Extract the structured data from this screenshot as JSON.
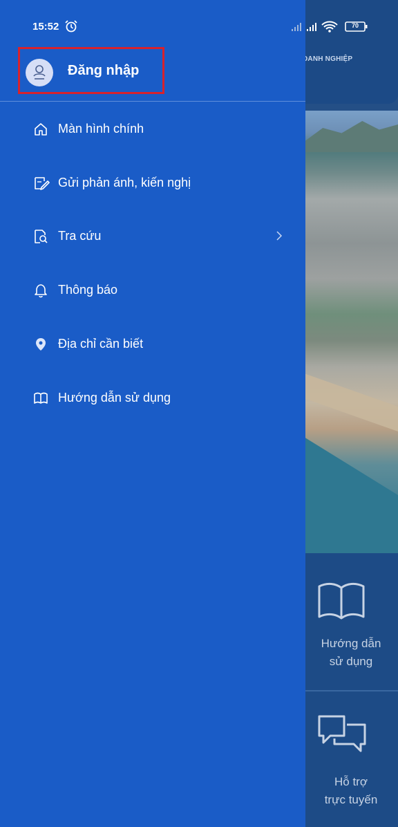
{
  "status_bar": {
    "time": "15:52",
    "battery": "70"
  },
  "drawer": {
    "login_label": "Đăng nhập",
    "menu": [
      {
        "label": "Màn hình chính",
        "icon": "home-icon"
      },
      {
        "label": "Gửi phản ánh, kiến nghị",
        "icon": "feedback-icon"
      },
      {
        "label": "Tra cứu",
        "icon": "search-document-icon",
        "has_submenu": true
      },
      {
        "label": "Thông báo",
        "icon": "bell-icon"
      },
      {
        "label": "Địa chỉ cần biết",
        "icon": "location-pin-icon"
      },
      {
        "label": "Hướng dẫn sử dụng",
        "icon": "book-icon"
      }
    ]
  },
  "background": {
    "header_text": "DANH NGHIỆP",
    "tiles": [
      {
        "label_line1": "Hướng dẫn",
        "label_line2": "sử dụng",
        "icon": "book-icon"
      },
      {
        "label_line1": "Hỗ trợ",
        "label_line2": "trực tuyến",
        "icon": "chat-icon"
      }
    ]
  },
  "colors": {
    "drawer_bg": "#1a5cc7",
    "highlight_border": "#d7222d",
    "background_tile": "#1d4b86"
  }
}
